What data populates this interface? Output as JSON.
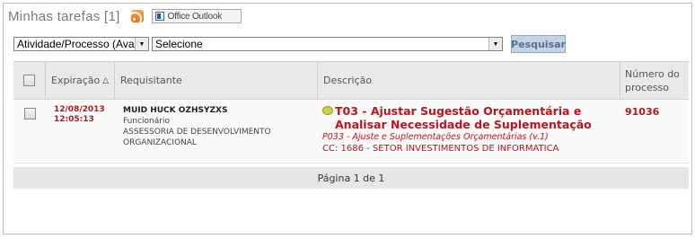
{
  "header": {
    "title": "Minhas tarefas [1]",
    "rss_icon": "rss-feed-icon",
    "outlook_label": "Office Outlook"
  },
  "filters": {
    "type_select_value": "Atividade/Processo (Ava",
    "process_select_value": "Selecione",
    "search_label": "Pesquisar"
  },
  "table": {
    "columns": {
      "expiration": "Expiração",
      "requester": "Requisitante",
      "description": "Descrição",
      "process_number": "Número do processo"
    },
    "rows": [
      {
        "date": "12/08/2013",
        "time": "12:05:13",
        "requester_name": "MUID HUCK OZHSYZXS",
        "requester_role": "Funcionário",
        "requester_dept": "ASSESSORIA DE DESENVOLVIMENTO ORGANIZACIONAL",
        "task_title": "T03 - Ajustar Sugestão Orçamentária e Analisar Necessidade de Suplementação",
        "process_name": "P033 - Ajuste e Suplementações Orçamentárias (v.1)",
        "cost_center": "CC: 1686 - SETOR INVESTIMENTOS DE INFORMATICA",
        "process_number": "91036"
      }
    ]
  },
  "pagination": {
    "text": "Página 1 de 1"
  },
  "colors": {
    "accent_red": "#c0141a",
    "header_bg": "#e9e9e9",
    "button_bg": "#c3d4e8"
  }
}
